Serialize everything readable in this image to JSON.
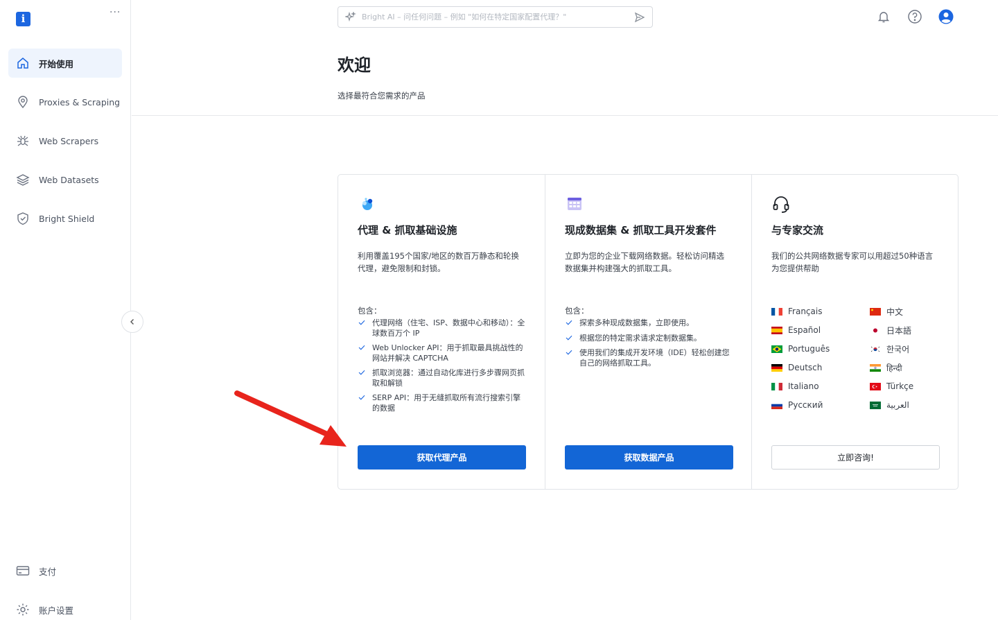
{
  "sidebar": {
    "logo_text": "i",
    "more_label": "···",
    "items": [
      {
        "label": "开始使用",
        "icon": "home-icon"
      },
      {
        "label": "Proxies & Scraping",
        "icon": "location-pin-icon"
      },
      {
        "label": "Web Scrapers",
        "icon": "spider-icon"
      },
      {
        "label": "Web Datasets",
        "icon": "layers-icon"
      },
      {
        "label": "Bright Shield",
        "icon": "shield-check-icon"
      }
    ],
    "bottom": [
      {
        "label": "支付",
        "icon": "credit-card-icon"
      },
      {
        "label": "账户设置",
        "icon": "gear-icon"
      }
    ]
  },
  "search": {
    "placeholder": "Bright AI – 问任何问题 – 例如 \"如何在特定国家配置代理？\""
  },
  "header": {
    "title": "欢迎",
    "subtitle": "选择最符合您需求的产品"
  },
  "cards": [
    {
      "title": "代理 & 抓取基础设施",
      "desc": "利用覆盖195个国家/地区的数百万静态和轮换代理，避免限制和封锁。",
      "includes_label": "包含：",
      "features": [
        "代理网络（住宅、ISP、数据中心和移动）：全球数百万个 IP",
        "Web Unlocker API：用于抓取最具挑战性的网站并解决 CAPTCHA",
        "抓取浏览器：通过自动化库进行多步骤网页抓取和解锁",
        "SERP API：用于无缝抓取所有流行搜索引擎的数据"
      ],
      "button": "获取代理产品"
    },
    {
      "title": "现成数据集 & 抓取工具开发套件",
      "desc": "立即为您的企业下载网络数据。轻松访问精选数据集并构建强大的抓取工具。",
      "includes_label": "包含：",
      "features": [
        "探索多种现成数据集，立即使用。",
        "根据您的特定需求请求定制数据集。",
        "使用我们的集成开发环境（IDE）轻松创建您自己的网络抓取工具。"
      ],
      "button": "获取数据产品"
    },
    {
      "title": "与专家交流",
      "desc": "我们的公共网络数据专家可以用超过50种语言为您提供帮助",
      "languages": [
        {
          "label": "Français",
          "flag": "fr"
        },
        {
          "label": "中文",
          "flag": "cn"
        },
        {
          "label": "Español",
          "flag": "es"
        },
        {
          "label": "日本語",
          "flag": "jp"
        },
        {
          "label": "Português",
          "flag": "br"
        },
        {
          "label": "한국어",
          "flag": "kr"
        },
        {
          "label": "Deutsch",
          "flag": "de"
        },
        {
          "label": "हिन्दी",
          "flag": "in"
        },
        {
          "label": "Italiano",
          "flag": "it"
        },
        {
          "label": "Türkçe",
          "flag": "tr"
        },
        {
          "label": "Русский",
          "flag": "ru"
        },
        {
          "label": "العربية",
          "flag": "sa"
        }
      ],
      "button": "立即咨询!"
    }
  ],
  "colors": {
    "primary": "#1366d6",
    "arrow": "#e8241c",
    "active_bg": "#eef4fd"
  }
}
